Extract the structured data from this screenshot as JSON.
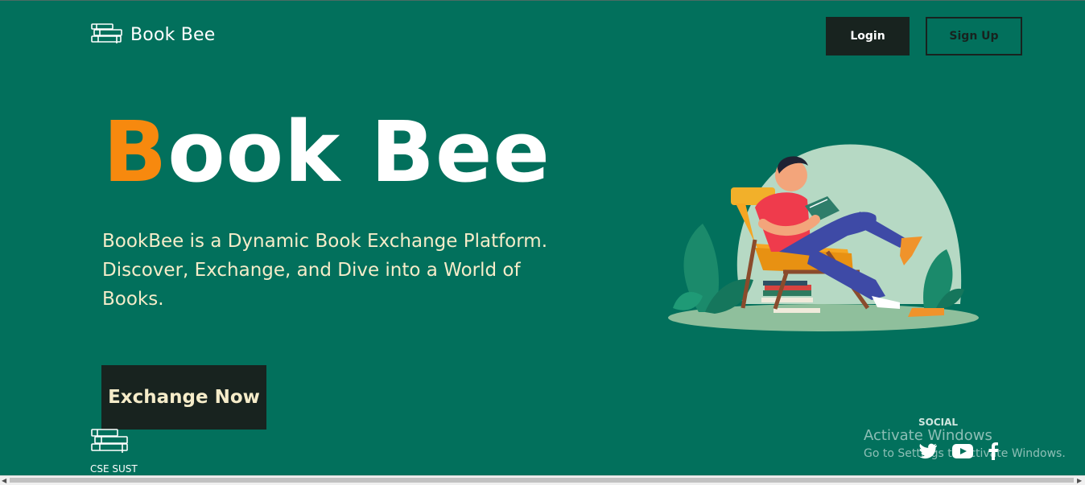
{
  "header": {
    "brand": "Book Bee",
    "login_label": "Login",
    "signup_label": "Sign Up"
  },
  "hero": {
    "title_first": "B",
    "title_rest": "ook Bee",
    "description": "BookBee is a Dynamic Book Exchange Platform. Discover, Exchange, and Dive into a World of Books.",
    "cta_label": "Exchange Now"
  },
  "footer": {
    "label": "CSE SUST",
    "social_title": "SOCIAL",
    "social_icons": [
      "twitter-icon",
      "youtube-icon",
      "facebook-icon"
    ]
  },
  "windows_watermark": {
    "line1": "Activate Windows",
    "line2": "Go to Settings to activate Windows."
  },
  "colors": {
    "background": "#02705c",
    "accent": "#f7890e",
    "dark": "#18231f",
    "cream": "#f5ecc9"
  }
}
